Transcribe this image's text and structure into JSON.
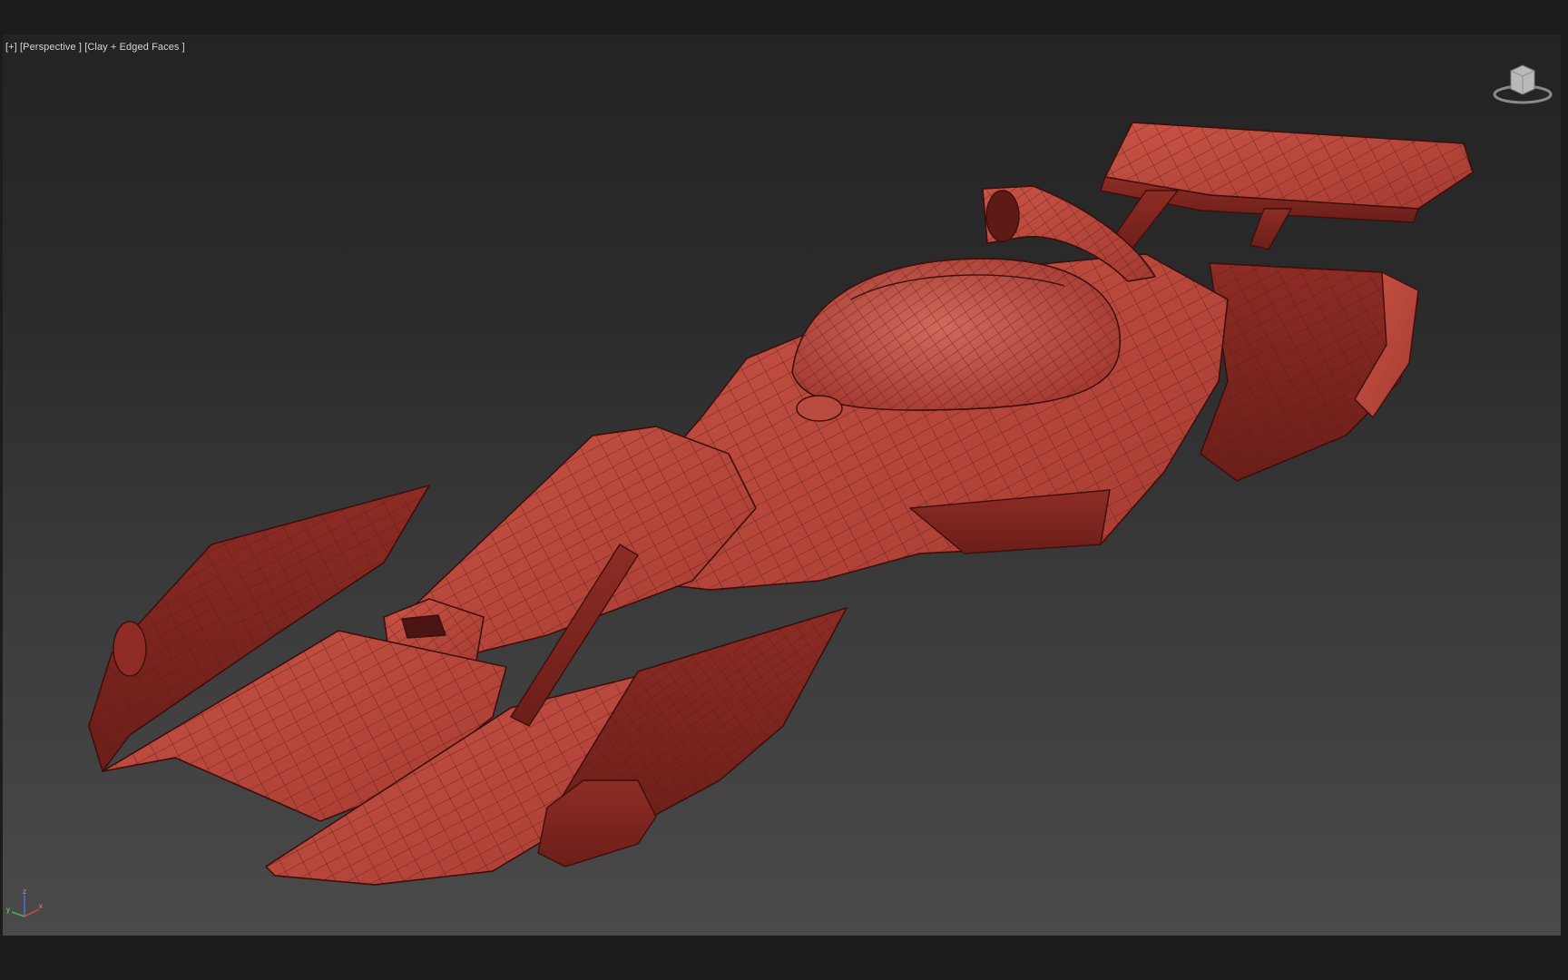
{
  "viewport": {
    "label_plus": "[+]",
    "label_view": "[Perspective ]",
    "label_shading": "[Clay + Edged Faces ]"
  },
  "model": {
    "name": "race-car-mesh",
    "fill_color": "#b84a3f",
    "edge_color": "#4a1512"
  },
  "viewcube": {
    "icon": "viewcube-icon"
  },
  "axis_tripod": {
    "icon": "axis-tripod-icon",
    "x": "x",
    "y": "y",
    "z": "z"
  }
}
